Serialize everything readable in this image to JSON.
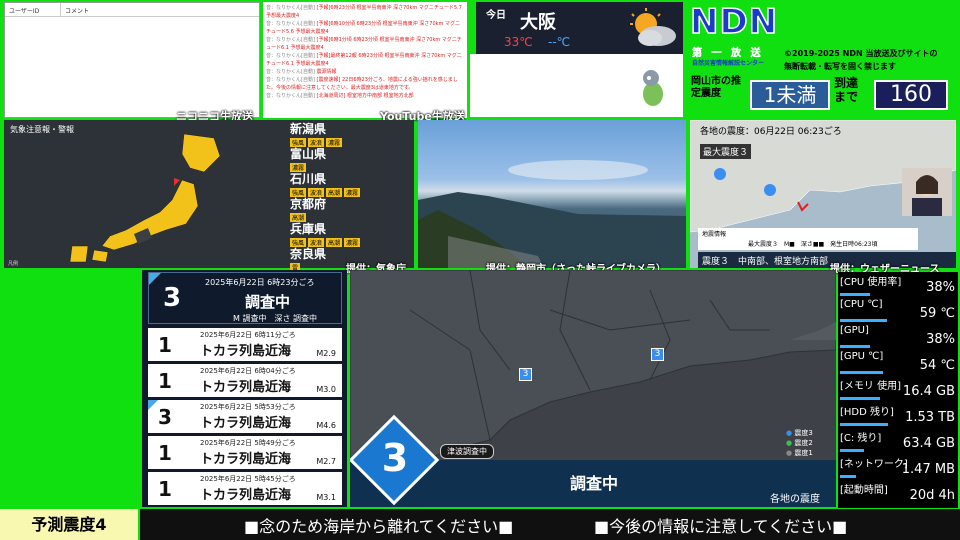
{
  "comments": {
    "col_user": "ユーザーID",
    "col_comment": "コメント",
    "watermark": "ニコニコ生放送"
  },
  "youtube": {
    "watermark": "YouTube生放送",
    "lines": [
      {
        "user": "音：なりかくん[自動]",
        "msg": "[予報]6時23分頃 根室半島南東沖 深さ70km マグニチュード5.7 予想最大震度4"
      },
      {
        "user": "音：なりかくん[自動]",
        "msg": "[予報]6時10分頃 6時23分頃 根室半島南東沖 深さ70km マグニチュード5.6 予想最大震度4"
      },
      {
        "user": "音：なりかくん[自動]",
        "msg": "[予報]6時1分頃 6時23分頃 根室半島南東沖 深さ70km マグニチュード6.1 予想最大震度4"
      },
      {
        "user": "音：なりかくん[自動]",
        "msg": "[予報]最終第12報 6時23分頃 根室半島南東沖 深さ70km マグニチュード6.1 予想最大震度4"
      },
      {
        "user": "音：なりかくん[自動]",
        "msg": "震源情報"
      },
      {
        "user": "音：なりかくん[自動]",
        "msg": "[震度速報] 22日6時23分ごろ、地震による強い揺れを感じました。今後の情報に注意してください。最大震度3は道東地方です。"
      },
      {
        "user": "音：なりかくん[自動]",
        "msg": "[北海道周辺] 根室地方中南部 根室地方北部"
      }
    ]
  },
  "weather": {
    "label": "今日",
    "city": "大阪",
    "high": "33℃",
    "low": "--℃"
  },
  "ndn": {
    "title": "NDN",
    "sub1": "第 一 放 送",
    "sub2": "自然災害情報解説センター",
    "copy1": "©2019-2025 NDN 当放送及びサイトの",
    "copy2": "無断転載・転写を固く禁じます",
    "est_label": "岡山市の推定震度",
    "est_value": "1未満",
    "arr_label": "到達まで",
    "arr_value": "160"
  },
  "jma": {
    "title": "気象注意報・警報",
    "credit": "提供：気象庁",
    "prefs": [
      {
        "name": "新潟県",
        "tags": [
          "強風",
          "波浪",
          "濃霧"
        ]
      },
      {
        "name": "富山県",
        "tags": [
          "濃霧"
        ]
      },
      {
        "name": "石川県",
        "tags": [
          "強風",
          "波浪",
          "高潮",
          "濃霧"
        ]
      },
      {
        "name": "京都府",
        "tags": [
          "高潮"
        ]
      },
      {
        "name": "兵庫県",
        "tags": [
          "強風",
          "波浪",
          "高潮",
          "濃霧"
        ]
      },
      {
        "name": "奈良県",
        "tags": [
          "雷"
        ]
      }
    ]
  },
  "camera": {
    "credit": "提供：静岡市（さった峠ライブカメラ）"
  },
  "wn": {
    "credit": "提供：ウェザーニュース",
    "time_label": "各地の震度：06月22日 06:23ごろ",
    "max_label": "最大震度３",
    "info_head": "地震情報",
    "info_line": "最大震度３　M■　深さ■■　発生日時06:23頃",
    "area_int": "震度３",
    "area": "中南部、根室地方南部"
  },
  "quakes": {
    "latest": {
      "int": "3",
      "date": "2025年6月22日 6時23分ごろ",
      "loc": "調査中",
      "detail": "M 調査中　深さ 調査中"
    },
    "items": [
      {
        "int": "1",
        "date": "2025年6月22日 6時11分ごろ",
        "loc": "トカラ列島近海",
        "mag": "M2.9",
        "flag": false
      },
      {
        "int": "1",
        "date": "2025年6月22日 6時04分ごろ",
        "loc": "トカラ列島近海",
        "mag": "M3.0",
        "flag": false
      },
      {
        "int": "3",
        "date": "2025年6月22日 5時53分ごろ",
        "loc": "トカラ列島近海",
        "mag": "M4.6",
        "flag": true
      },
      {
        "int": "1",
        "date": "2025年6月22日 5時49分ごろ",
        "loc": "トカラ列島近海",
        "mag": "M2.7",
        "flag": false
      },
      {
        "int": "1",
        "date": "2025年6月22日 5時45分ごろ",
        "loc": "トカラ列島近海",
        "mag": "M3.1",
        "flag": false
      }
    ]
  },
  "mainmap": {
    "int": "3",
    "tsunami": "津波調査中",
    "status": "調査中",
    "footer": "各地の震度",
    "legend": [
      "震度3",
      "震度2",
      "震度1"
    ],
    "markers": [
      "3",
      "3"
    ]
  },
  "sys": [
    {
      "k": "[CPU 使用率]",
      "v": "38%",
      "level": 0.38
    },
    {
      "k": "[CPU ℃]",
      "v": "59 ℃",
      "level": 0.59
    },
    {
      "k": "[GPU]",
      "v": "38%",
      "level": 0.38
    },
    {
      "k": "[GPU ℃]",
      "v": "54 ℃",
      "level": 0.54
    },
    {
      "k": "[メモリ 使用]",
      "v": "16.4 GB",
      "level": 0.5
    },
    {
      "k": "[HDD 残り]",
      "v": "1.53 TB",
      "level": 0.6
    },
    {
      "k": "[C: 残り]",
      "v": "63.4 GB",
      "level": 0.3
    },
    {
      "k": "[ネットワーク]",
      "v": "1.47 MB",
      "level": 0.2
    },
    {
      "k": "[起動時間]",
      "v": "20d 4h",
      "level": 0
    }
  ],
  "ticker": {
    "forecast": "予測震度4",
    "msg1": "■念のため海岸から離れてください■",
    "msg2": "■今後の情報に注意してください■"
  }
}
